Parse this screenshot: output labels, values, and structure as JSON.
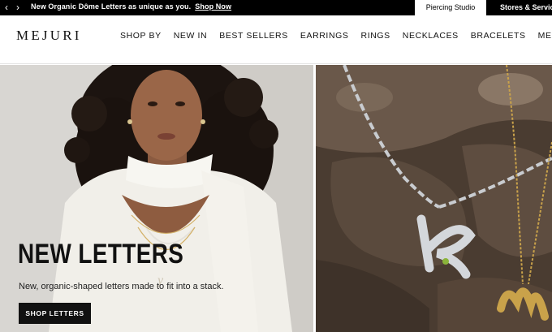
{
  "announcement": {
    "message": "New Organic Dôme Letters as unique as you.",
    "cta": "Shop Now"
  },
  "top_tabs": {
    "piercing": "Piercing Studio",
    "stores": "Stores & Services"
  },
  "header": {
    "logo": "MEJURI",
    "nav": [
      "SHOP BY",
      "NEW IN",
      "BEST SELLERS",
      "EARRINGS",
      "RINGS",
      "NECKLACES",
      "BRACELETS",
      "MEN'S"
    ]
  },
  "hero": {
    "title": "NEW LETTERS",
    "subtitle": "New, organic-shaped letters made to fit into a stack.",
    "button": "SHOP LETTERS"
  },
  "colors": {
    "black": "#000000",
    "white": "#ffffff",
    "gold": "#c9a24a",
    "silver": "#c8ccd0"
  }
}
